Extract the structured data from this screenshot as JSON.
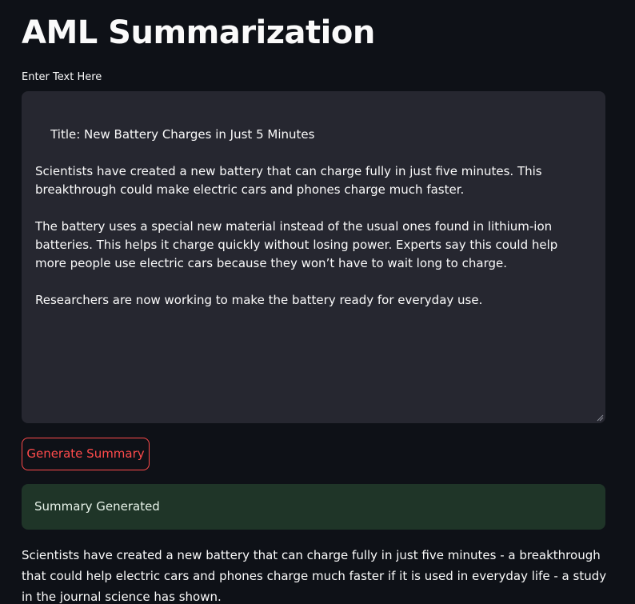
{
  "header": {
    "title": "AML Summarization"
  },
  "input": {
    "label": "Enter Text Here",
    "value": "Title: New Battery Charges in Just 5 Minutes\n\nScientists have created a new battery that can charge fully in just five minutes. This breakthrough could make electric cars and phones charge much faster.\n\nThe battery uses a special new material instead of the usual ones found in lithium-ion batteries. This helps it charge quickly without losing power. Experts say this could help more people use electric cars because they won’t have to wait long to charge.\n\nResearchers are now working to make the battery ready for everyday use."
  },
  "actions": {
    "generate_label": "Generate Summary"
  },
  "status": {
    "message": "Summary Generated",
    "color": "#1f3528"
  },
  "output": {
    "summary": "Scientists have created a new battery that can charge fully in just five minutes - a breakthrough that could help electric cars and phones charge much faster if it is used in everyday life - a study in the journal science has shown."
  },
  "theme": {
    "background": "#0e1117",
    "input_background": "#262730",
    "accent": "#ff4b4b"
  }
}
